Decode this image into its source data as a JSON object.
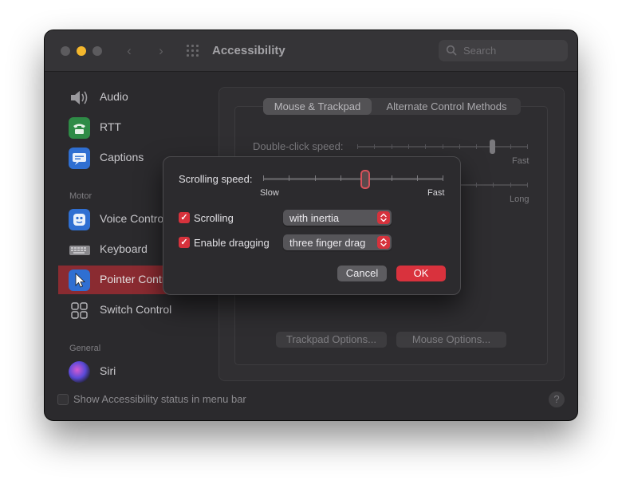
{
  "window": {
    "title": "Accessibility",
    "search_placeholder": "Search",
    "nav_back": "‹",
    "nav_forward": "›"
  },
  "sidebar": {
    "items": [
      {
        "label": "Audio",
        "icon": "speaker-icon"
      },
      {
        "label": "RTT",
        "icon": "rtt-phone-icon"
      },
      {
        "label": "Captions",
        "icon": "captions-icon"
      },
      {
        "label": "Voice Control",
        "icon": "voice-control-icon"
      },
      {
        "label": "Keyboard",
        "icon": "keyboard-icon"
      },
      {
        "label": "Pointer Control",
        "icon": "pointer-icon"
      },
      {
        "label": "Switch Control",
        "icon": "switch-control-icon"
      },
      {
        "label": "Siri",
        "icon": "siri-icon"
      }
    ],
    "section_motor": "Motor",
    "section_general": "General"
  },
  "pointer_panel": {
    "tabs": [
      "Mouse & Trackpad",
      "Alternate Control Methods"
    ],
    "double_click_label": "Double-click speed:",
    "double_click_fast": "Fast",
    "spring_long": "Long",
    "trackpad_options_button": "Trackpad Options...",
    "mouse_options_button": "Mouse Options..."
  },
  "status_bar": {
    "checkbox_label": "Show Accessibility status in menu bar",
    "help": "?"
  },
  "sheet": {
    "scrolling_speed_label": "Scrolling speed:",
    "slow_label": "Slow",
    "fast_label": "Fast",
    "scrolling_speed_value": 0.56,
    "scrolling_checkbox_label": "Scrolling",
    "scrolling_checked": true,
    "scrolling_mode": "with inertia",
    "dragging_checkbox_label": "Enable dragging",
    "dragging_checked": true,
    "dragging_mode": "three finger drag",
    "cancel_button": "Cancel",
    "ok_button": "OK"
  },
  "colors": {
    "accent": "#d6323c",
    "selection": "#8a2b31",
    "window_bg": "#2b2a2d"
  }
}
